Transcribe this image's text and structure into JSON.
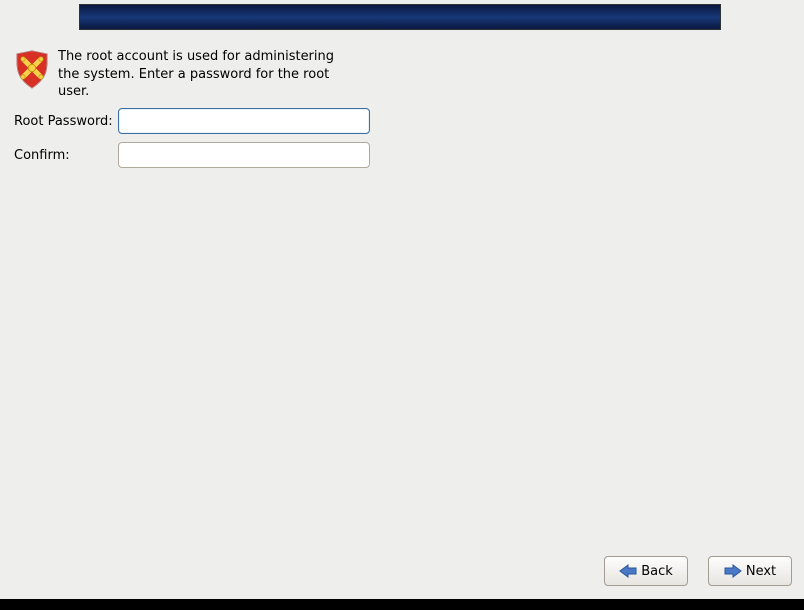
{
  "info": {
    "text": "The root account is used for administering the system.  Enter a password for the root user."
  },
  "fields": {
    "root_password_label": "Root Password:",
    "root_password_value": "",
    "confirm_label": "Confirm:",
    "confirm_value": ""
  },
  "buttons": {
    "back_label": "Back",
    "next_label": "Next"
  }
}
